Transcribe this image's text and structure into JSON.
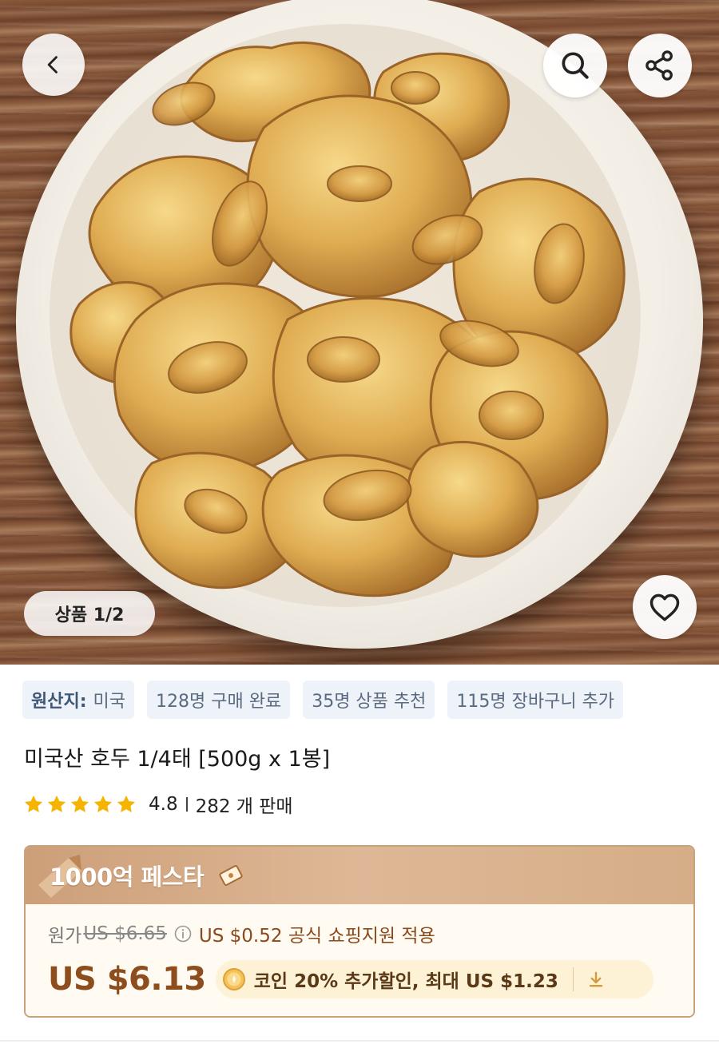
{
  "hero": {
    "image_counter": "상품 1/2",
    "icons": {
      "back": "chevron-left-icon",
      "search": "search-icon",
      "share": "share-icon",
      "wishlist": "heart-outline-icon"
    }
  },
  "tags": [
    {
      "label": "원산지:",
      "value": "미국"
    },
    {
      "label": "",
      "value": "128명 구매 완료"
    },
    {
      "label": "",
      "value": "35명 상품 추천"
    },
    {
      "label": "",
      "value": "115명 장바구니 추가"
    }
  ],
  "product": {
    "title": "미국산 호두 1/4태  [500g x 1봉]",
    "rating": "4.8",
    "stars": 5,
    "sold": "282 개 판매"
  },
  "price": {
    "festival_title": "1000억 페스타",
    "original_label": "원가",
    "original_price": "US $6.65",
    "support_text": "US $0.52 공식 쇼핑지원 적용",
    "final_price": "US $6.13",
    "coin_text": "코인 20% 추가할인, 최대 US $1.23"
  },
  "colors": {
    "accent_brown": "#8e4d1d",
    "star": "#f5b400",
    "tag_bg": "#eef3f9",
    "card_border": "#c9a27a"
  }
}
